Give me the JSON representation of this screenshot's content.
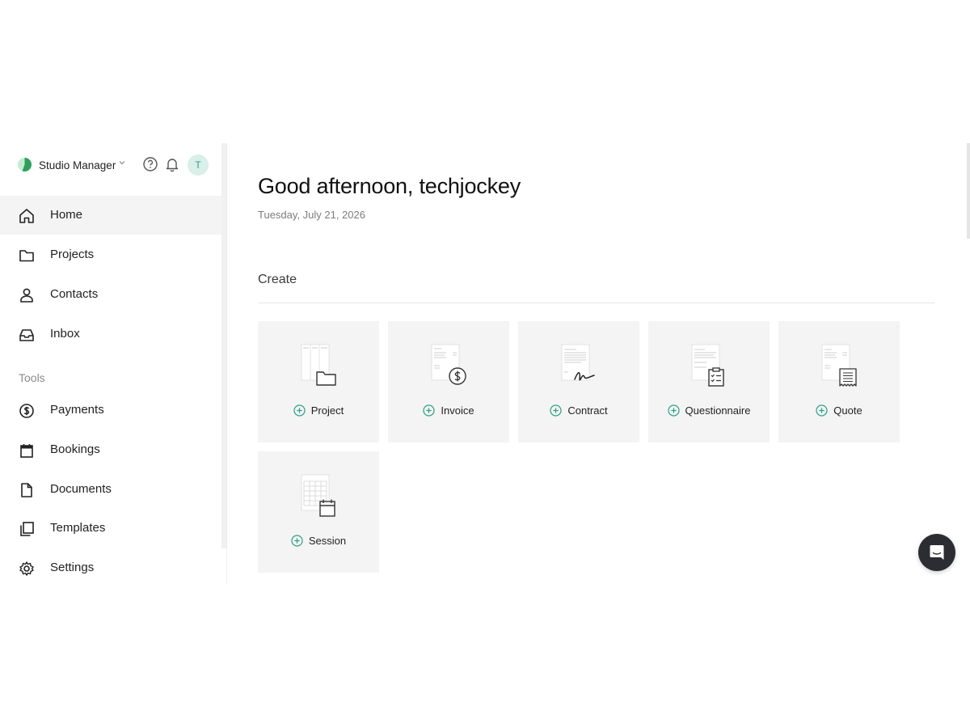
{
  "brand": {
    "name": "Studio Manager",
    "avatar_initial": "T"
  },
  "header_icons": [
    "help-icon",
    "bell-icon"
  ],
  "nav": {
    "items": [
      {
        "label": "Home",
        "icon": "home-icon",
        "active": true
      },
      {
        "label": "Projects",
        "icon": "folder-icon"
      },
      {
        "label": "Contacts",
        "icon": "person-icon"
      },
      {
        "label": "Inbox",
        "icon": "inbox-icon"
      }
    ],
    "tools_label": "Tools",
    "tools": [
      {
        "label": "Payments",
        "icon": "dollar-circle-icon"
      },
      {
        "label": "Bookings",
        "icon": "calendar-icon"
      },
      {
        "label": "Documents",
        "icon": "document-icon"
      },
      {
        "label": "Templates",
        "icon": "templates-icon"
      },
      {
        "label": "Settings",
        "icon": "gear-icon"
      }
    ]
  },
  "main": {
    "greeting": "Good afternoon, techjockey",
    "date": "Tuesday, July 21, 2026",
    "create_title": "Create",
    "cards": [
      {
        "label": "Project",
        "icon": "project-folder-icon"
      },
      {
        "label": "Invoice",
        "icon": "invoice-dollar-icon"
      },
      {
        "label": "Contract",
        "icon": "contract-signature-icon"
      },
      {
        "label": "Questionnaire",
        "icon": "questionnaire-clipboard-icon"
      },
      {
        "label": "Quote",
        "icon": "quote-receipt-icon"
      },
      {
        "label": "Session",
        "icon": "session-calendar-icon"
      }
    ]
  },
  "colors": {
    "accent": "#2f9f86",
    "card_bg": "#f3f4f3",
    "active_nav_bg": "#f3f4f3"
  }
}
